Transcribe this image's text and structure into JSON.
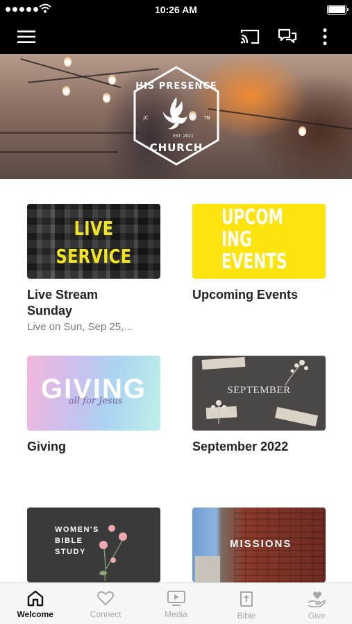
{
  "status_bar": {
    "time": "10:26 AM"
  },
  "app_bar": {
    "menu_icon": "hamburger-menu-icon",
    "actions": [
      "cast-icon",
      "chat-icon",
      "more-vertical-icon"
    ]
  },
  "hero": {
    "logo_top": "HIS PRESENCE",
    "logo_bottom": "CHURCH",
    "logo_left": "JC",
    "logo_right": "TN",
    "logo_est": "EST. 2021"
  },
  "cards": [
    {
      "thumb_line1": "LIVE",
      "thumb_line2": "SERVICE",
      "title": "Live Stream Sunday",
      "subtitle": "Live on Sun, Sep 25,..."
    },
    {
      "thumb_text": "UPCOM\nING\nEVENTS",
      "title": "Upcoming Events"
    },
    {
      "thumb_text": "GIVING",
      "thumb_script": "all for Jesus",
      "title": "Giving"
    },
    {
      "thumb_text": "SEPTEMBER",
      "title": "September 2022"
    },
    {
      "thumb_text": "WOMEN'S\nBIBLE\nSTUDY"
    },
    {
      "thumb_text": "MISSIONS"
    }
  ],
  "tabs": [
    {
      "label": "Welcome",
      "icon": "home-icon",
      "active": true
    },
    {
      "label": "Connect",
      "icon": "heart-icon",
      "active": false
    },
    {
      "label": "Media",
      "icon": "play-screen-icon",
      "active": false
    },
    {
      "label": "Bible",
      "icon": "bible-icon",
      "active": false
    },
    {
      "label": "Give",
      "icon": "hand-heart-icon",
      "active": false
    }
  ]
}
